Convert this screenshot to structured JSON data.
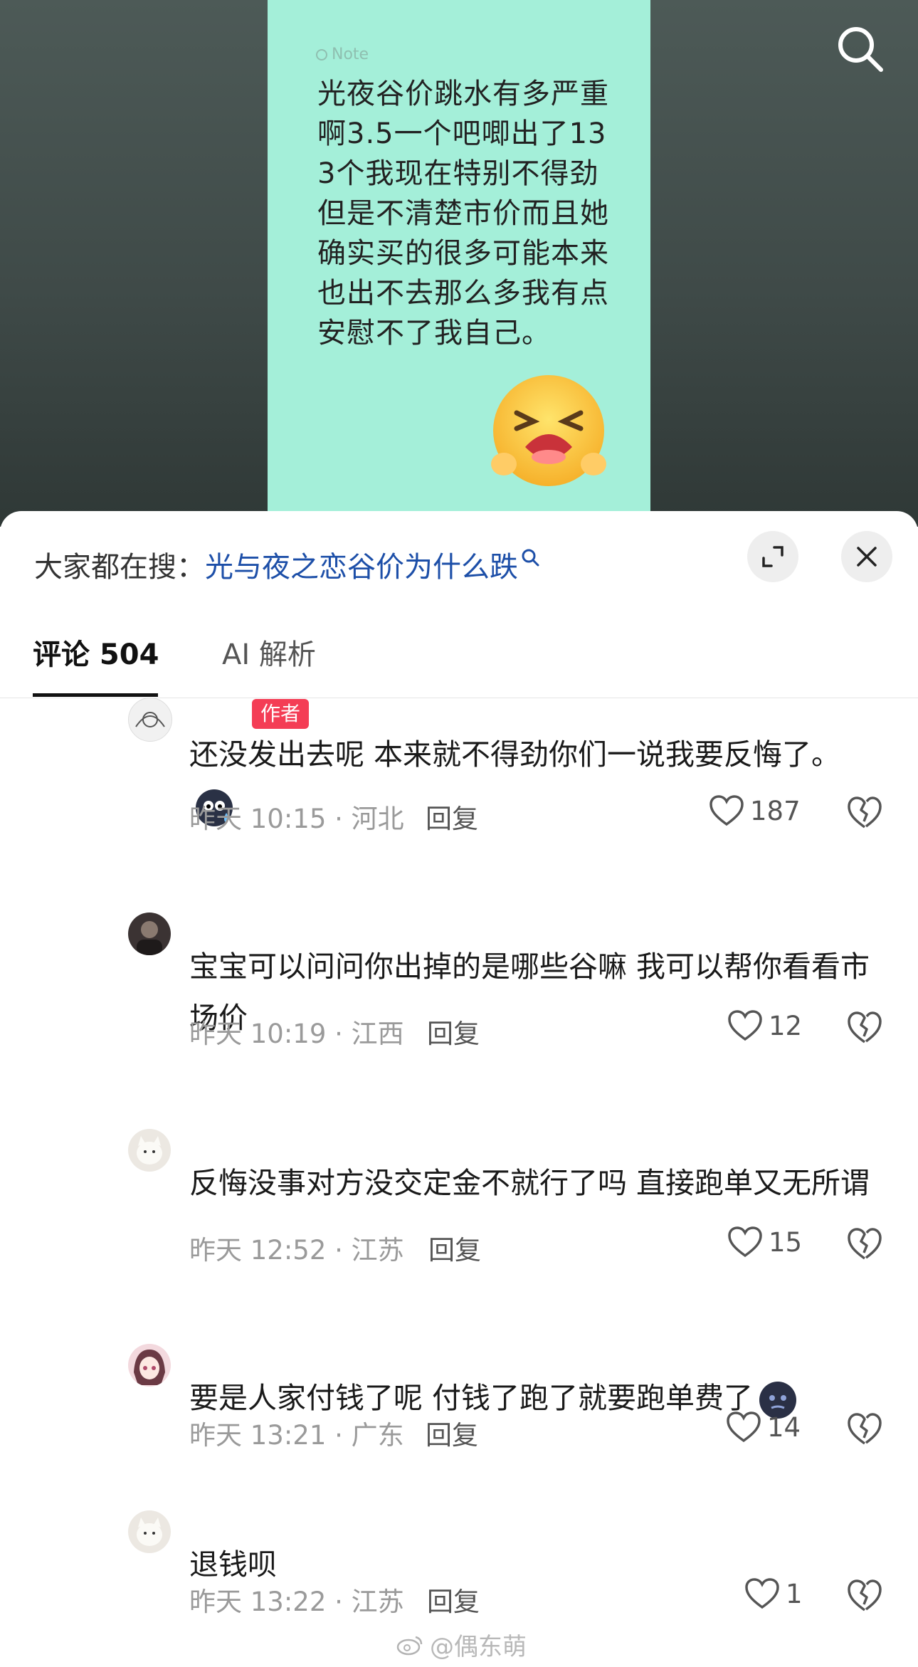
{
  "note": {
    "tag": "Note",
    "text": "光夜谷价跳水有多严重啊3.5一个吧唧出了133个我现在特别不得劲但是不清楚市价而且她确实买的很多可能本来也出不去那么多我有点安慰不了我自己。"
  },
  "trending": {
    "prefix": "大家都在搜：",
    "query": "光与夜之恋谷价为什么跌"
  },
  "tabs": {
    "comments": "评论 504",
    "ai": "AI 解析"
  },
  "comments": [
    {
      "username": "",
      "badge": "作者",
      "text": "还没发出去呢 本来就不得劲你们一说我要反悔了。",
      "time": "昨天 10:15 · 河北",
      "reply": "回复",
      "likes": "187"
    },
    {
      "username": "",
      "text": "宝宝可以问问你出掉的是哪些谷嘛 我可以帮你看看市场价",
      "time": "昨天 10:19 · 江西",
      "reply": "回复",
      "likes": "12"
    },
    {
      "username": "",
      "text": "反悔没事对方没交定金不就行了吗 直接跑单又无所谓",
      "time": "昨天 12:52 · 江苏",
      "reply": "回复",
      "likes": "15"
    },
    {
      "username": "",
      "text": "要是人家付钱了呢 付钱了跑了就要跑单费了",
      "time": "昨天 13:21 · 广东",
      "reply": "回复",
      "likes": "14"
    },
    {
      "username": "",
      "text": "退钱呗",
      "time": "昨天 13:22 · 江苏",
      "reply": "回复",
      "likes": "1"
    }
  ],
  "watermark": "@偶东萌",
  "colors": {
    "note_bg": "#a4efd9",
    "query_blue": "#1d4fa8",
    "author_badge": "#f43d55"
  }
}
